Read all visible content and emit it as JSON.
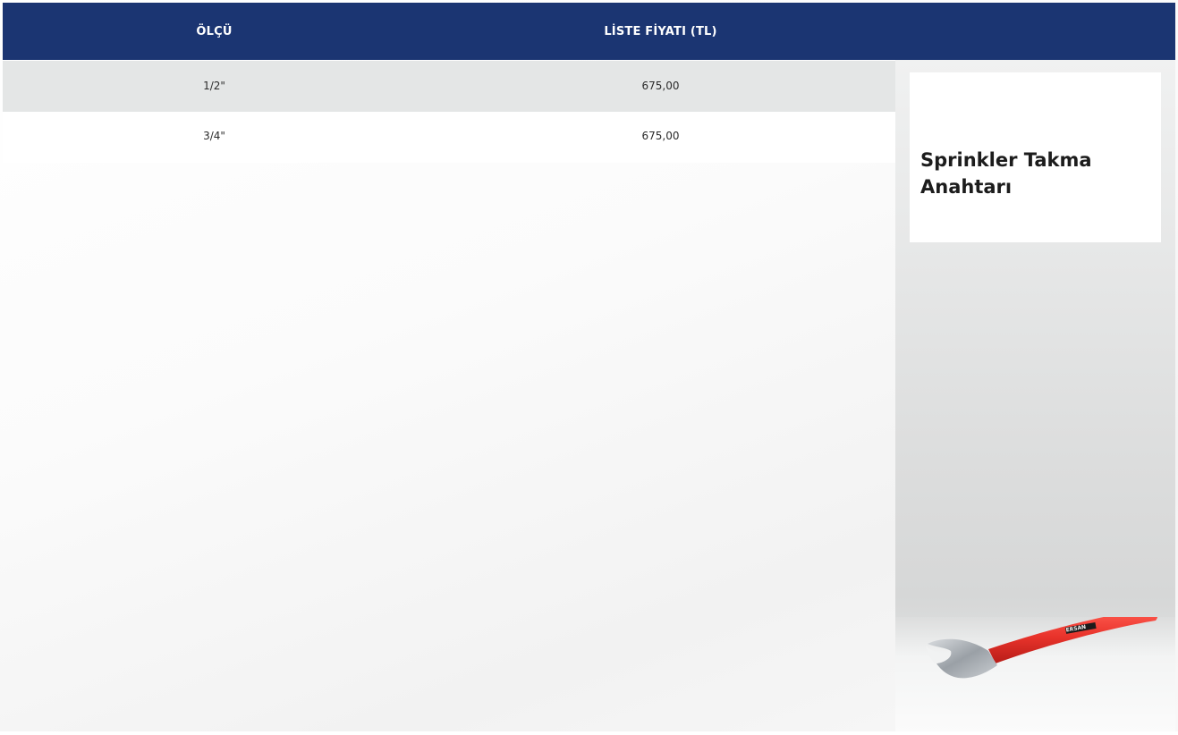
{
  "table": {
    "headers": {
      "size": "ÖLÇÜ",
      "price": "LİSTE FİYATI (TL)"
    },
    "rows": [
      {
        "size": "1/2\"",
        "price": "675,00"
      },
      {
        "size": "3/4\"",
        "price": "675,00"
      }
    ]
  },
  "product": {
    "title": "Sprinkler Takma\nAnahtarı",
    "image_icon": "sprinkler-wrench-icon",
    "image_brand_text": "ERSAN"
  },
  "colors": {
    "header_bg": "#1b3572",
    "header_text": "#ffffff",
    "row_alt_bg": "#e4e6e6",
    "wrench_handle": "#e8332b"
  }
}
